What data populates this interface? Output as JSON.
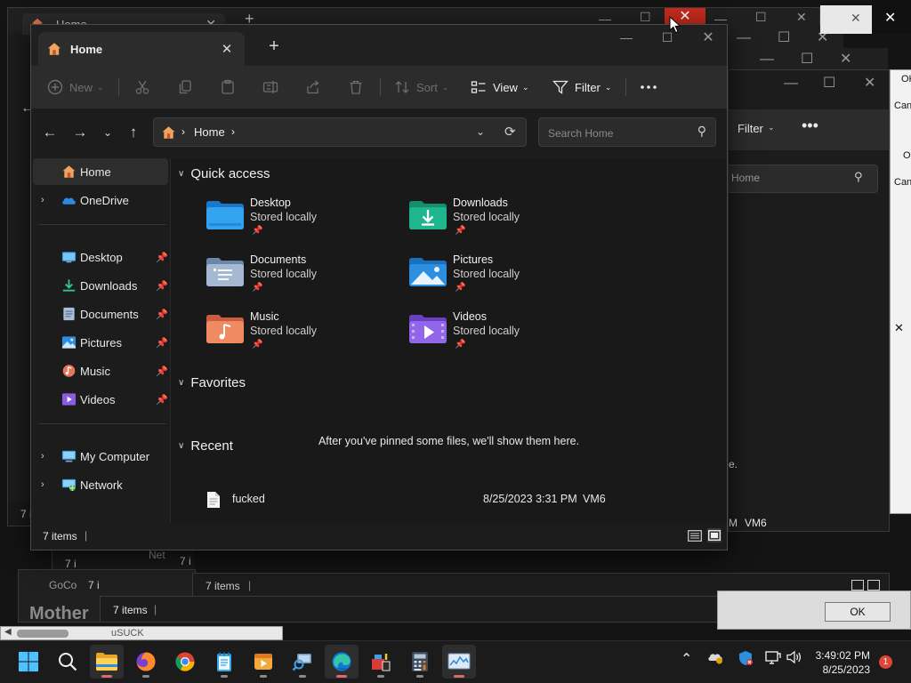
{
  "explorer": {
    "tab_title": "Home",
    "toolbar": {
      "new_label": "New",
      "sort_label": "Sort",
      "view_label": "View",
      "filter_label": "Filter"
    },
    "breadcrumb": {
      "location": "Home"
    },
    "search": {
      "placeholder": "Search Home"
    },
    "nav": {
      "home": "Home",
      "onedrive": "OneDrive",
      "pinned": [
        {
          "label": "Desktop",
          "icon": "desktop-icon"
        },
        {
          "label": "Downloads",
          "icon": "downloads-icon"
        },
        {
          "label": "Documents",
          "icon": "documents-icon"
        },
        {
          "label": "Pictures",
          "icon": "pictures-icon"
        },
        {
          "label": "Music",
          "icon": "music-icon"
        },
        {
          "label": "Videos",
          "icon": "videos-icon"
        }
      ],
      "my_computer": "My Computer",
      "network": "Network"
    },
    "quick_access": {
      "header": "Quick access",
      "items": [
        {
          "name": "Desktop",
          "sub": "Stored locally"
        },
        {
          "name": "Downloads",
          "sub": "Stored locally"
        },
        {
          "name": "Documents",
          "sub": "Stored locally"
        },
        {
          "name": "Pictures",
          "sub": "Stored locally"
        },
        {
          "name": "Music",
          "sub": "Stored locally"
        },
        {
          "name": "Videos",
          "sub": "Stored locally"
        }
      ]
    },
    "favorites": {
      "header": "Favorites",
      "empty_message": "After you've pinned some files, we'll show them here."
    },
    "recent": {
      "header": "Recent",
      "items": [
        {
          "name": "fucked",
          "date": "8/25/2023 3:31 PM",
          "location": "VM6"
        }
      ]
    },
    "status": {
      "item_count": "7 items"
    }
  },
  "background": {
    "window_title": "Home",
    "filter_label": "Filter",
    "search_placeholder": "Search Home",
    "status_a": "7 items",
    "status_b": "7 items",
    "recent_location": "VM6",
    "ok_label": "OK",
    "dialog_ok": "OK",
    "dialog_cancel": "Canc",
    "fragment_net": "Net",
    "fragment_goco": "GoCo",
    "fragment_mother": "Mother",
    "fragment_suck": "uSUCK",
    "fragment_e": "e."
  },
  "taskbar": {
    "time": "3:49:02 PM",
    "date": "8/25/2023",
    "notification_count": "1"
  },
  "colors": {
    "close_hover": "#c42b1c",
    "accent_blue": "#4cc2ff",
    "folder_desktop": "#1e90e0",
    "folder_downloads": "#1fb58f",
    "folder_documents": "#8aa6c7",
    "folder_pictures": "#2d8fe0",
    "folder_music": "#e8745a",
    "folder_videos": "#8a5ce0"
  }
}
